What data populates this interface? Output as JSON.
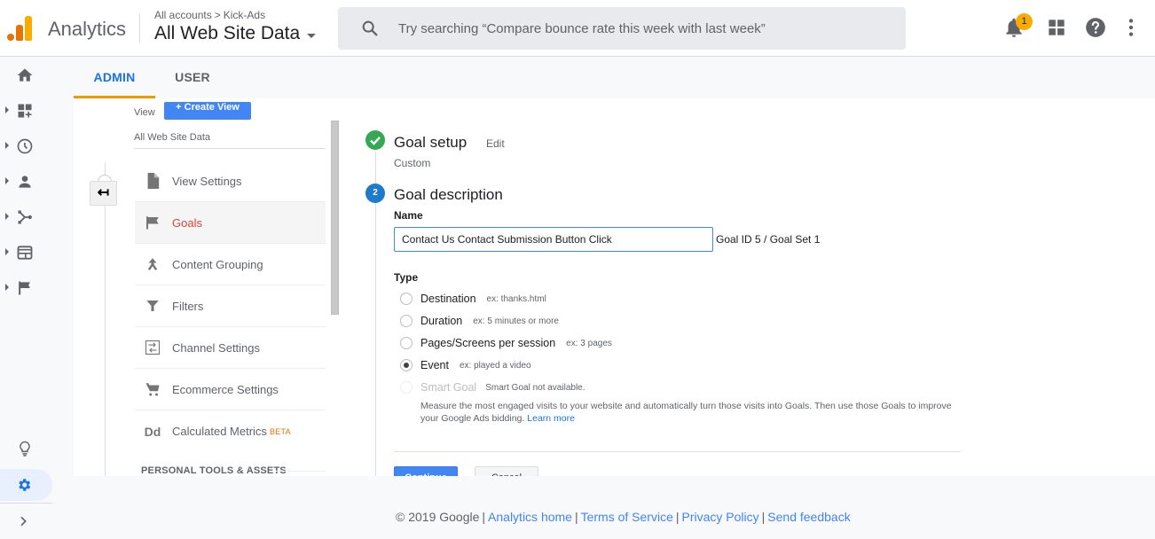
{
  "header": {
    "app_name": "Analytics",
    "breadcrumb": [
      "All accounts",
      "Kick-Ads"
    ],
    "breadcrumb_separator": ">",
    "view_name": "All Web Site Data",
    "search_placeholder": "Try searching “Compare bounce rate this week with last week”",
    "notification_count": "1",
    "icons": [
      "search-icon",
      "bell-icon",
      "apps-grid-icon",
      "help-icon",
      "more-vert-icon"
    ]
  },
  "left_nav": {
    "items": [
      {
        "name": "home",
        "icon": "home-icon"
      },
      {
        "name": "customization",
        "icon": "dashboard-icon"
      },
      {
        "name": "realtime",
        "icon": "clock-icon"
      },
      {
        "name": "audience",
        "icon": "person-icon"
      },
      {
        "name": "acquisition",
        "icon": "acquisition-icon"
      },
      {
        "name": "behavior",
        "icon": "behavior-icon"
      },
      {
        "name": "conversions",
        "icon": "flag-icon"
      }
    ],
    "bottom": [
      {
        "name": "discover",
        "icon": "lightbulb-icon"
      },
      {
        "name": "admin",
        "icon": "gear-icon",
        "active": true
      },
      {
        "name": "expand",
        "icon": "chevron-right-icon"
      }
    ]
  },
  "tabs": [
    {
      "label": "ADMIN",
      "active": true
    },
    {
      "label": "USER",
      "active": false
    }
  ],
  "admin_column": {
    "column_label": "View",
    "create_button": "+ Create View",
    "view_name": "All Web Site Data",
    "items": [
      {
        "label": "View Settings",
        "icon": "document-icon"
      },
      {
        "label": "Goals",
        "icon": "flag-icon",
        "active": true
      },
      {
        "label": "Content Grouping",
        "icon": "content-grouping-icon"
      },
      {
        "label": "Filters",
        "icon": "filter-icon"
      },
      {
        "label": "Channel Settings",
        "icon": "channel-settings-icon"
      },
      {
        "label": "Ecommerce Settings",
        "icon": "cart-icon"
      },
      {
        "label": "Calculated Metrics",
        "icon": "dd-icon",
        "icon_text": "Dd",
        "badge": "BETA"
      }
    ],
    "section_heading": "PERSONAL TOOLS & ASSETS",
    "back_glyph": "↤"
  },
  "goal_editor": {
    "step1": {
      "title": "Goal setup",
      "edit": "Edit",
      "value": "Custom"
    },
    "step2": {
      "number": "2",
      "title": "Goal description"
    },
    "name_label": "Name",
    "name_value": "Contact Us Contact Submission Button Click",
    "goal_id": "Goal ID 5 / Goal Set 1",
    "type_label": "Type",
    "types": [
      {
        "label": "Destination",
        "example": "ex: thanks.html",
        "checked": false
      },
      {
        "label": "Duration",
        "example": "ex: 5 minutes or more",
        "checked": false
      },
      {
        "label": "Pages/Screens per session",
        "example": "ex: 3 pages",
        "checked": false
      },
      {
        "label": "Event",
        "example": "ex: played a video",
        "checked": true
      },
      {
        "label": "Smart Goal",
        "example": "Smart Goal not available.",
        "checked": false,
        "disabled": true
      }
    ],
    "smart_goal_description": "Measure the most engaged visits to your website and automatically turn those visits into Goals. Then use those Goals to improve your Google Ads bidding.",
    "learn_more": "Learn more",
    "continue_label": "Continue",
    "cancel_label": "Cancel"
  },
  "footer": {
    "copyright": "© 2019 Google",
    "links": [
      "Analytics home",
      "Terms of Service",
      "Privacy Policy",
      "Send feedback"
    ]
  },
  "colors": {
    "accent_blue": "#1a73e8",
    "tab_underline": "#f29900",
    "active_goal": "#db4437",
    "success_green": "#34a853",
    "step_blue": "#1e7bcc",
    "badge_yellow": "#f9ab00"
  }
}
